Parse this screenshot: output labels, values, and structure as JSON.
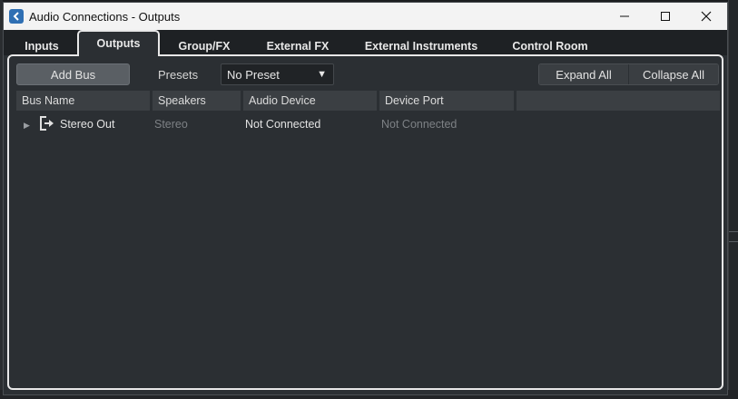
{
  "window": {
    "title": "Audio Connections - Outputs"
  },
  "tabs": [
    {
      "label": "Inputs"
    },
    {
      "label": "Outputs"
    },
    {
      "label": "Group/FX"
    },
    {
      "label": "External FX"
    },
    {
      "label": "External Instruments"
    },
    {
      "label": "Control Room"
    }
  ],
  "toolbar": {
    "add_bus_label": "Add Bus",
    "presets_label": "Presets",
    "preset_value": "No Preset",
    "expand_all_label": "Expand All",
    "collapse_all_label": "Collapse All"
  },
  "table": {
    "columns": [
      "Bus Name",
      "Speakers",
      "Audio Device",
      "Device Port",
      ""
    ],
    "rows": [
      {
        "bus_name": "Stereo Out",
        "speakers": "Stereo",
        "audio_device": "Not Connected",
        "device_port": "Not Connected"
      }
    ]
  },
  "colors": {
    "accent_active_tab": "#e8e8e8",
    "window_bg": "#2b2f33",
    "icon_blue": "#2f6fb3"
  }
}
